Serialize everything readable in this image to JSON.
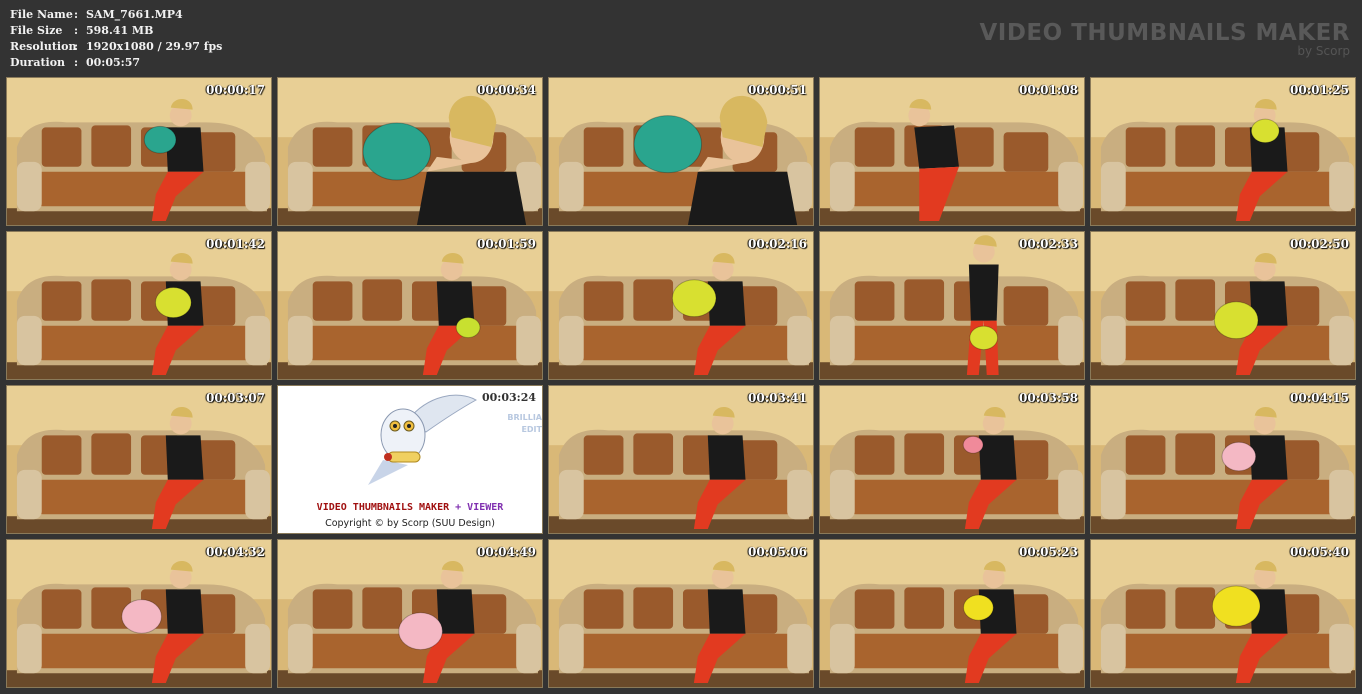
{
  "info": {
    "rows": [
      {
        "key": "File Name",
        "sep": ":",
        "value": "SAM_7661.MP4"
      },
      {
        "key": "File Size",
        "sep": ":",
        "value": "598.41 MB"
      },
      {
        "key": "Resolution",
        "sep": ":",
        "value": "1920x1080 / 29.97 fps"
      },
      {
        "key": "Duration",
        "sep": ":",
        "value": "00:05:57"
      }
    ]
  },
  "brand": {
    "title": "VIDEO THUMBNAILS MAKER",
    "subtitle": "by Scorp"
  },
  "splash": {
    "title_main": "VIDEO THUMBNAILS MAKER",
    "title_plus": " + VIEWER",
    "copyright": "Copyright © by Scorp (SUU Design)",
    "side_line1": "BRILLIA",
    "side_line2": "EDIT"
  },
  "thumbs": [
    {
      "time": "00:00:17",
      "balloon": "#2aa58e",
      "bx": 0.58,
      "by": 0.42,
      "br": 16,
      "pose": "sit"
    },
    {
      "time": "00:00:34",
      "balloon": "#2aa58e",
      "bx": 0.45,
      "by": 0.5,
      "br": 34,
      "pose": "close"
    },
    {
      "time": "00:00:51",
      "balloon": "#2aa58e",
      "bx": 0.45,
      "by": 0.45,
      "br": 34,
      "pose": "close"
    },
    {
      "time": "00:01:08",
      "balloon": "",
      "bx": 0,
      "by": 0,
      "br": 0,
      "pose": "lean"
    },
    {
      "time": "00:01:25",
      "balloon": "#d8e030",
      "bx": 0.66,
      "by": 0.36,
      "br": 14,
      "pose": "sit"
    },
    {
      "time": "00:01:42",
      "balloon": "#d8e030",
      "bx": 0.63,
      "by": 0.48,
      "br": 18,
      "pose": "sit"
    },
    {
      "time": "00:01:59",
      "balloon": "#c8e030",
      "bx": 0.72,
      "by": 0.65,
      "br": 12,
      "pose": "sit"
    },
    {
      "time": "00:02:16",
      "balloon": "#d8e030",
      "bx": 0.55,
      "by": 0.45,
      "br": 22,
      "pose": "sit"
    },
    {
      "time": "00:02:33",
      "balloon": "#d8e030",
      "bx": 0.62,
      "by": 0.72,
      "br": 14,
      "pose": "stand"
    },
    {
      "time": "00:02:50",
      "balloon": "#d8e030",
      "bx": 0.55,
      "by": 0.6,
      "br": 22,
      "pose": "sit"
    },
    {
      "time": "00:03:07",
      "balloon": "",
      "bx": 0,
      "by": 0,
      "br": 0,
      "pose": "sit"
    },
    {
      "time": "00:03:24",
      "splash": true
    },
    {
      "time": "00:03:41",
      "balloon": "",
      "bx": 0,
      "by": 0,
      "br": 0,
      "pose": "sit"
    },
    {
      "time": "00:03:58",
      "balloon": "#f08a9a",
      "bx": 0.58,
      "by": 0.4,
      "br": 10,
      "pose": "sit"
    },
    {
      "time": "00:04:15",
      "balloon": "#f4b8c4",
      "bx": 0.56,
      "by": 0.48,
      "br": 17,
      "pose": "sit"
    },
    {
      "time": "00:04:32",
      "balloon": "#f4b8c4",
      "bx": 0.51,
      "by": 0.52,
      "br": 20,
      "pose": "sit"
    },
    {
      "time": "00:04:49",
      "balloon": "#f4b8c4",
      "bx": 0.54,
      "by": 0.62,
      "br": 22,
      "pose": "sit"
    },
    {
      "time": "00:05:06",
      "balloon": "",
      "bx": 0,
      "by": 0,
      "br": 0,
      "pose": "sit"
    },
    {
      "time": "00:05:23",
      "balloon": "#f0e020",
      "bx": 0.6,
      "by": 0.46,
      "br": 15,
      "pose": "sit"
    },
    {
      "time": "00:05:40",
      "balloon": "#f0e020",
      "bx": 0.55,
      "by": 0.45,
      "br": 24,
      "pose": "sit"
    }
  ]
}
